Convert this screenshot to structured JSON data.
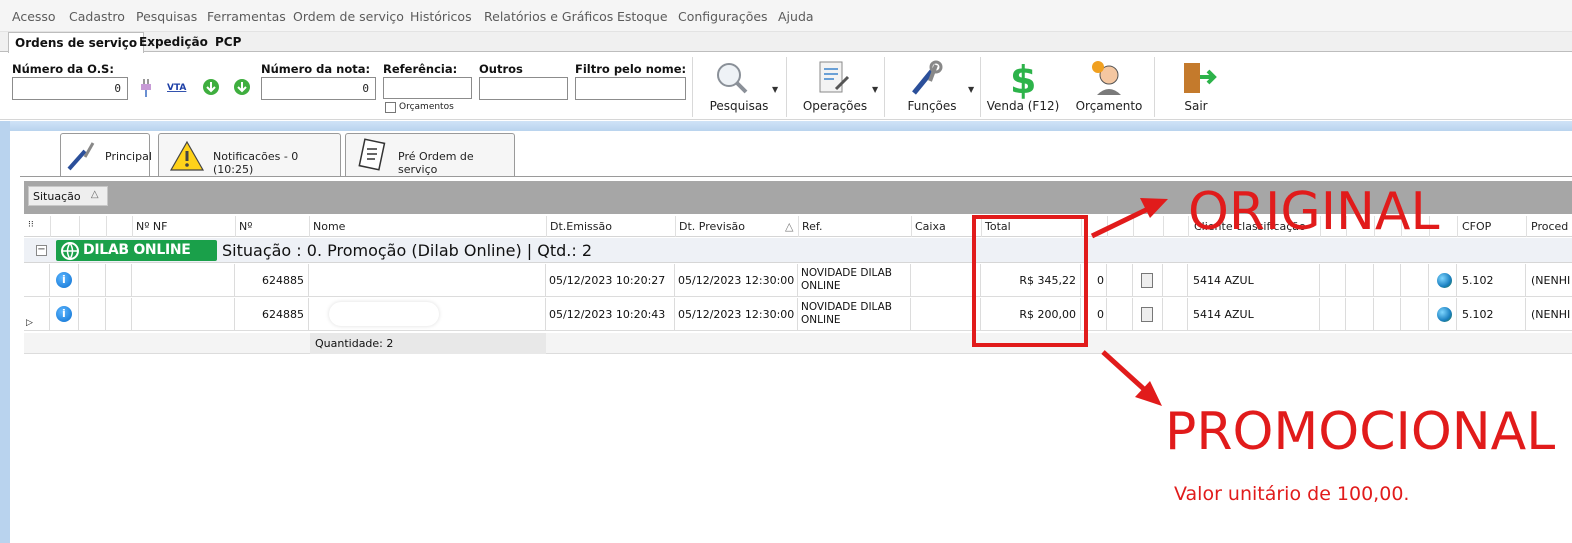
{
  "menu": [
    "Acesso",
    "Cadastro",
    "Pesquisas",
    "Ferramentas",
    "Ordem de serviço",
    "Históricos",
    "Relatórios e Gráficos",
    "Estoque",
    "Configurações",
    "Ajuda"
  ],
  "top_tabs": [
    "Ordens de serviço",
    "Expedição",
    "PCP"
  ],
  "toolbar": {
    "os_label": "Número da O.S:",
    "os_value": "0",
    "vta_label": "VTA",
    "nota_label": "Número da nota:",
    "nota_value": "0",
    "ref_label": "Referência:",
    "orcamentos_label": "Orçamentos",
    "outros_label": "Outros",
    "filtro_label": "Filtro pelo nome:",
    "buttons": {
      "pesquisas": "Pesquisas",
      "operacoes": "Operações",
      "funcoes": "Funções",
      "venda": "Venda (F12)",
      "orcamento": "Orçamento",
      "sair": "Sair"
    }
  },
  "content_tabs": {
    "principal": "Principal",
    "notificacoes": "Notificacões - 0 (10:25)",
    "pre_os": "Pré Ordem de serviço"
  },
  "group_by_chip": "Situação",
  "columns": {
    "nf": "Nº NF",
    "num": "Nº",
    "nome": "Nome",
    "emissao": "Dt.Emissão",
    "previsao": "Dt. Previsão",
    "ref": "Ref.",
    "caixa": "Caixa",
    "total": "Total",
    "cliente_class": "Cliente classificação",
    "cfop": "CFOP",
    "proced": "Proced"
  },
  "group": {
    "badge": "DILAB ONLINE",
    "text": "Situação : 0. Promoção (Dilab Online) | Qtd.: 2"
  },
  "rows": [
    {
      "num": "624885",
      "emissao": "05/12/2023 10:20:27",
      "previsao": "05/12/2023 12:30:00",
      "ref_l1": "NOVIDADE DILAB",
      "ref_l2": "ONLINE",
      "total": "R$ 345,22",
      "zero": "0",
      "cliente": "5414 AZUL",
      "cfop": "5.102",
      "proced": "(NENHI"
    },
    {
      "num": "624885",
      "emissao": "05/12/2023 10:20:43",
      "previsao": "05/12/2023 12:30:00",
      "ref_l1": "NOVIDADE DILAB",
      "ref_l2": "ONLINE",
      "total": "R$ 200,00",
      "zero": "0",
      "cliente": "5414 AZUL",
      "cfop": "5.102",
      "proced": "(NENHI"
    }
  ],
  "footer": {
    "quantidade": "Quantidade: 2"
  },
  "annotations": {
    "original": "ORIGINAL",
    "promocional": "PROMOCIONAL",
    "note": "Valor unitário de 100,00."
  },
  "colors": {
    "annotation_red": "#e11b1b",
    "dilab_green": "#1aa04a",
    "group_bar": "#a6a6a6"
  }
}
